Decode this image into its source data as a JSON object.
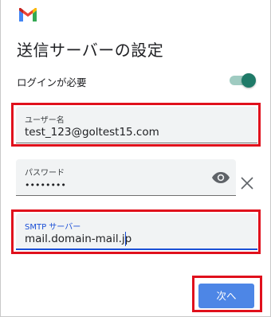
{
  "app": {
    "logo_icon": "gmail-logo"
  },
  "page": {
    "title": "送信サーバーの設定"
  },
  "auth_toggle": {
    "label": "ログインが必要",
    "enabled": true,
    "color": "#1f7a68"
  },
  "fields": {
    "username": {
      "label": "ユーザー名",
      "value": "test_123@goltest15.com"
    },
    "password": {
      "label": "パスワード",
      "value": "••••••••"
    },
    "smtp": {
      "label": "SMTP サーバー",
      "value": "mail.domain-mail.jp"
    }
  },
  "actions": {
    "next_label": "次へ"
  },
  "colors": {
    "accent": "#1a4fd6",
    "highlight": "#e0101c",
    "button": "#4d86e6"
  }
}
